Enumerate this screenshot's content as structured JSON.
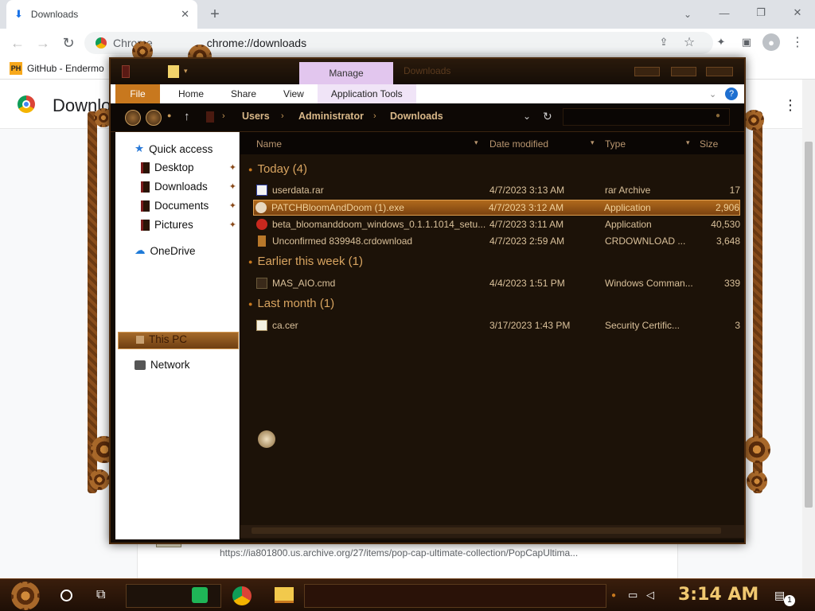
{
  "browser": {
    "tab_title": "Downloads",
    "address": "chrome://downloads",
    "address_prefix": "Chrome",
    "bookmark_badge": "PH",
    "bookmark_label": "GitHub - Endermo",
    "page_title": "Downloads",
    "download_url": "https://ia801800.us.archive.org/27/items/pop-cap-ultimate-collection/PopCapUltima..."
  },
  "explorer": {
    "window_title": "Downloads",
    "manage_label": "Manage",
    "ribbon": {
      "file": "File",
      "home": "Home",
      "share": "Share",
      "view": "View",
      "app_tools": "Application Tools"
    },
    "breadcrumb": [
      "Users",
      "Administrator",
      "Downloads"
    ],
    "nav": {
      "quick_access": "Quick access",
      "desktop": "Desktop",
      "downloads": "Downloads",
      "documents": "Documents",
      "pictures": "Pictures",
      "onedrive": "OneDrive",
      "this_pc": "This PC",
      "network": "Network"
    },
    "columns": {
      "name": "Name",
      "date": "Date modified",
      "type": "Type",
      "size": "Size"
    },
    "groups": [
      {
        "label": "Today (4)",
        "files": [
          {
            "name": "userdata.rar",
            "date": "4/7/2023 3:13 AM",
            "type": "rar Archive",
            "size": "17"
          },
          {
            "name": "PATCHBloomAndDoom (1).exe",
            "date": "4/7/2023 3:12 AM",
            "type": "Application",
            "size": "2,906"
          },
          {
            "name": "beta_bloomanddoom_windows_0.1.1.1014_setu...",
            "date": "4/7/2023 3:11 AM",
            "type": "Application",
            "size": "40,530"
          },
          {
            "name": "Unconfirmed 839948.crdownload",
            "date": "4/7/2023 2:59 AM",
            "type": "CRDOWNLOAD ...",
            "size": "3,648"
          }
        ]
      },
      {
        "label": "Earlier this week (1)",
        "files": [
          {
            "name": "MAS_AIO.cmd",
            "date": "4/4/2023 1:51 PM",
            "type": "Windows Comman...",
            "size": "339"
          }
        ]
      },
      {
        "label": "Last month (1)",
        "files": [
          {
            "name": "ca.cer",
            "date": "3/17/2023 1:43 PM",
            "type": "Security Certific...",
            "size": "3"
          }
        ]
      }
    ]
  },
  "taskbar": {
    "clock": "3:14 AM",
    "notification_count": "1"
  },
  "colors": {
    "accent_orange": "#c8781e",
    "explorer_bg": "#1c1208",
    "group_text": "#d8a460",
    "file_text": "#d9c09a",
    "clock": "#f0c870"
  }
}
